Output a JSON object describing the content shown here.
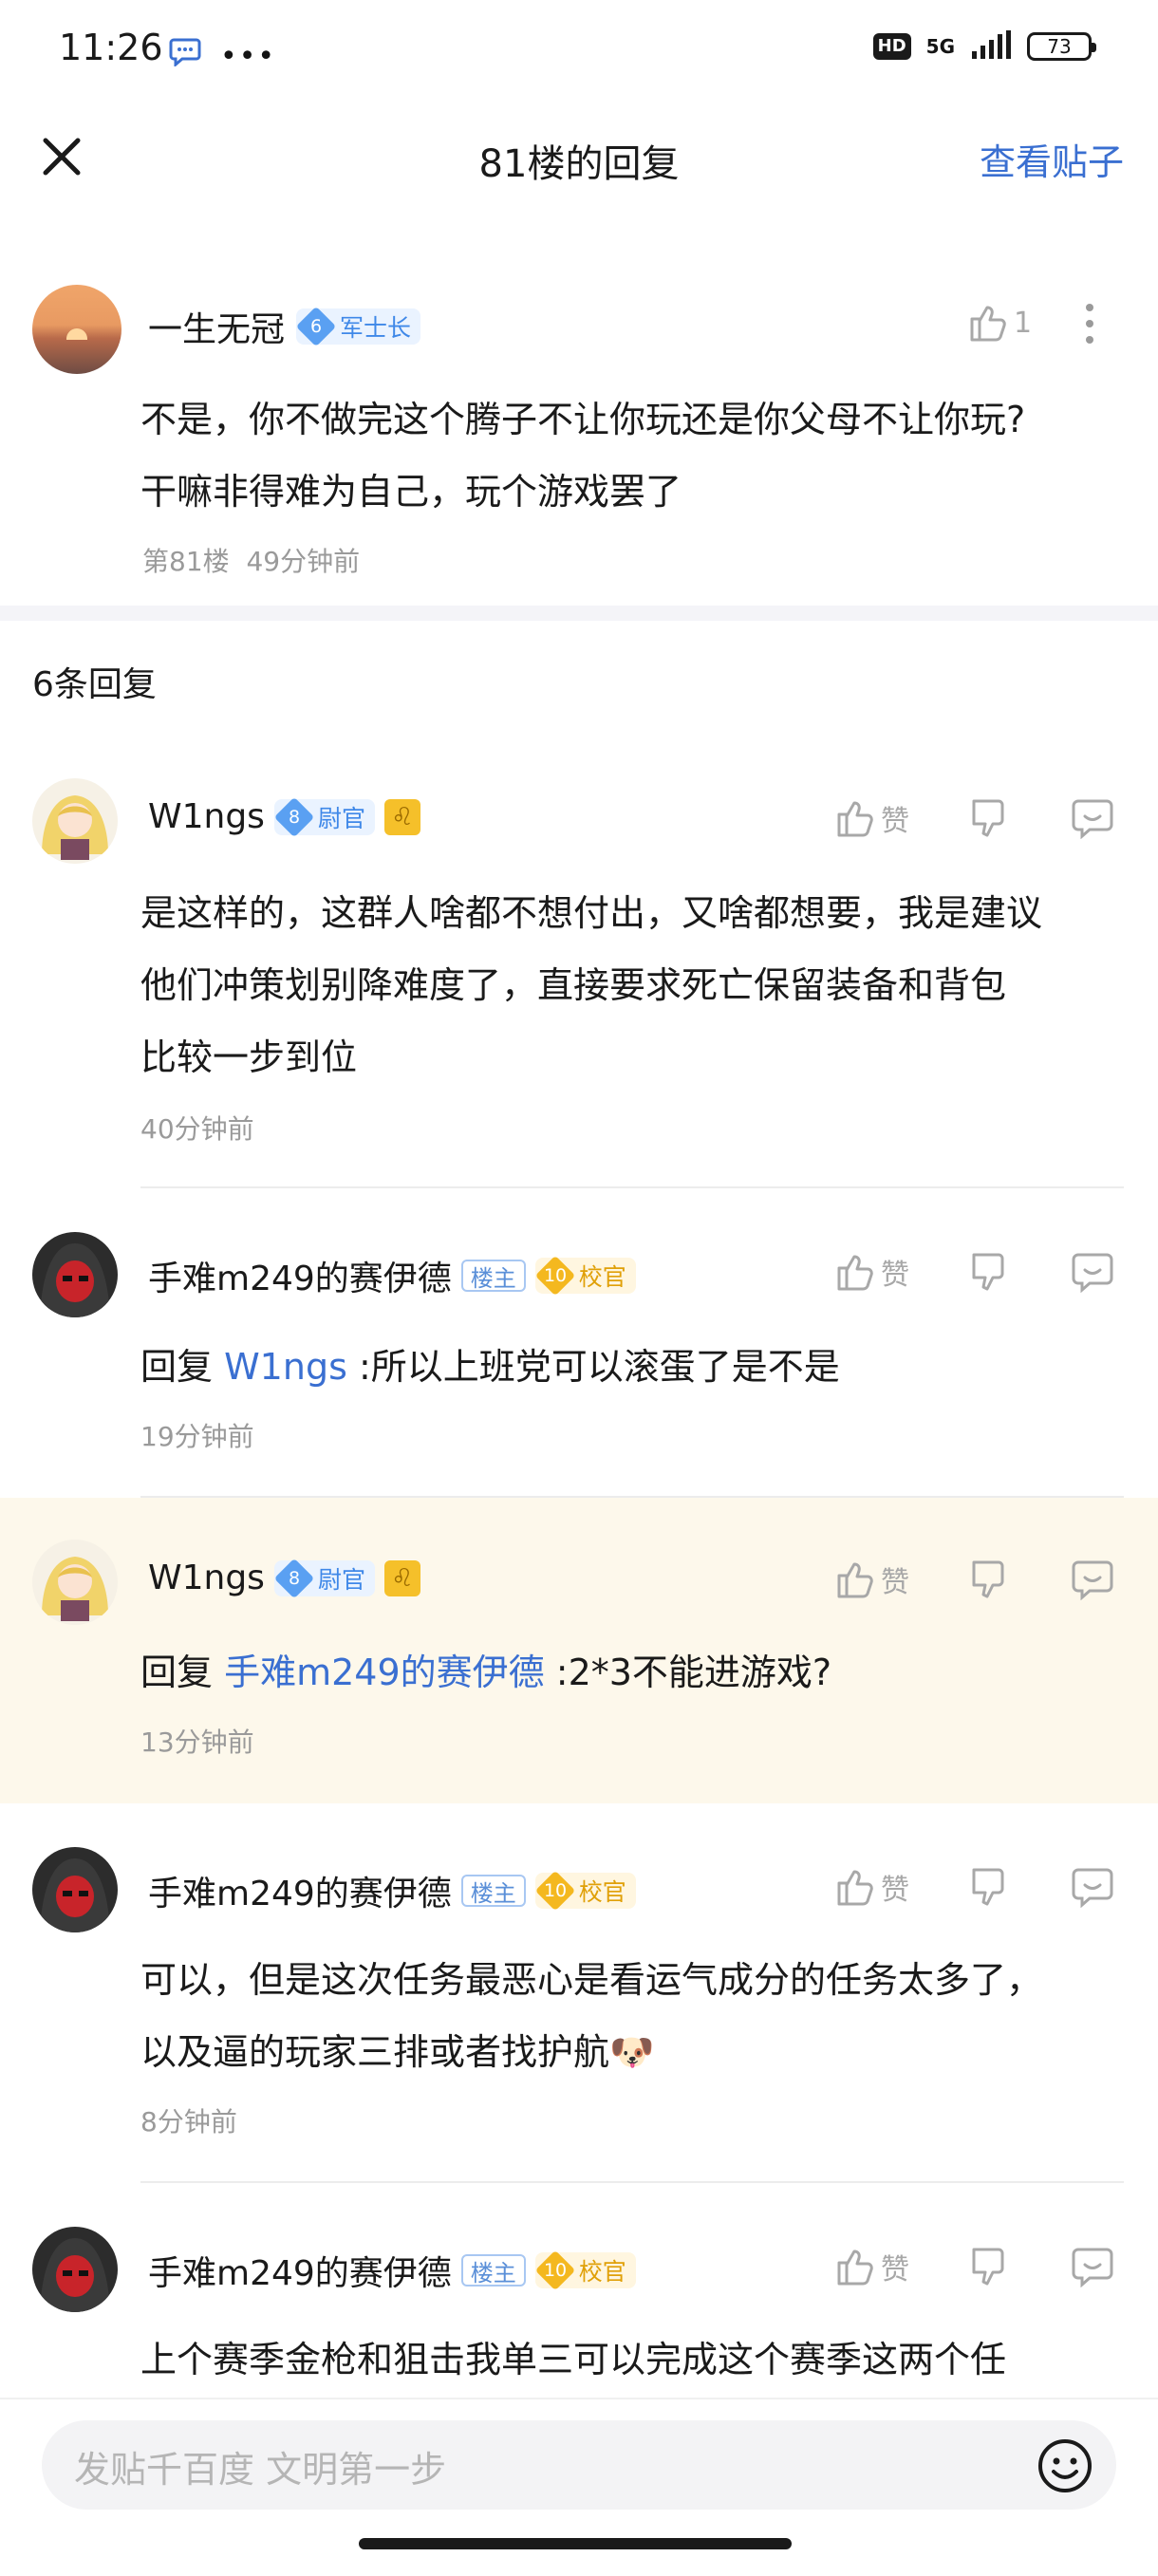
{
  "status_bar": {
    "time": "11:26",
    "network": "5G",
    "battery": "73"
  },
  "nav": {
    "title": "81楼的回复",
    "view_post": "查看贴子"
  },
  "main_post": {
    "username": "一生无冠",
    "level": "6",
    "level_title": "军士长",
    "like_count": "1",
    "text_line1": "不是，你不做完这个腾子不让你玩还是你父母不让你玩?",
    "text_line2": "干嘛非得难为自己，玩个游戏罢了",
    "floor": "第81楼",
    "time": "49分钟前"
  },
  "reply_count_label": "6条回复",
  "replies": [
    {
      "username": "W1ngs",
      "level": "8",
      "level_title": "尉官",
      "like_label": "赞",
      "line1": "是这样的，这群人啥都不想付出，又啥都想要，我是建议",
      "line2": "他们冲策划别降难度了，直接要求死亡保留装备和背包",
      "line3": "比较一步到位",
      "time": "40分钟前"
    },
    {
      "username": "手难m249的赛伊德",
      "host_tag": "楼主",
      "level": "10",
      "level_title": "校官",
      "like_label": "赞",
      "reply_prefix": "回复",
      "mention": "W1ngs",
      "text": ":所以上班党可以滚蛋了是不是",
      "time": "19分钟前"
    },
    {
      "username": "W1ngs",
      "level": "8",
      "level_title": "尉官",
      "like_label": "赞",
      "reply_prefix": "回复",
      "mention": "手难m249的赛伊德",
      "text": ":2*3不能进游戏?",
      "time": "13分钟前"
    },
    {
      "username": "手难m249的赛伊德",
      "host_tag": "楼主",
      "level": "10",
      "level_title": "校官",
      "like_label": "赞",
      "line1": "可以，但是这次任务最恶心是看运气成分的任务太多了，",
      "line2": "以及逼的玩家三排或者找护航🐶",
      "time": "8分钟前"
    },
    {
      "username": "手难m249的赛伊德",
      "host_tag": "楼主",
      "level": "10",
      "level_title": "校官",
      "like_label": "赞",
      "line1": "上个赛季金枪和狙击我单三可以完成这个赛季这两个任"
    }
  ],
  "composer": {
    "placeholder": "发贴千百度 文明第一步"
  }
}
